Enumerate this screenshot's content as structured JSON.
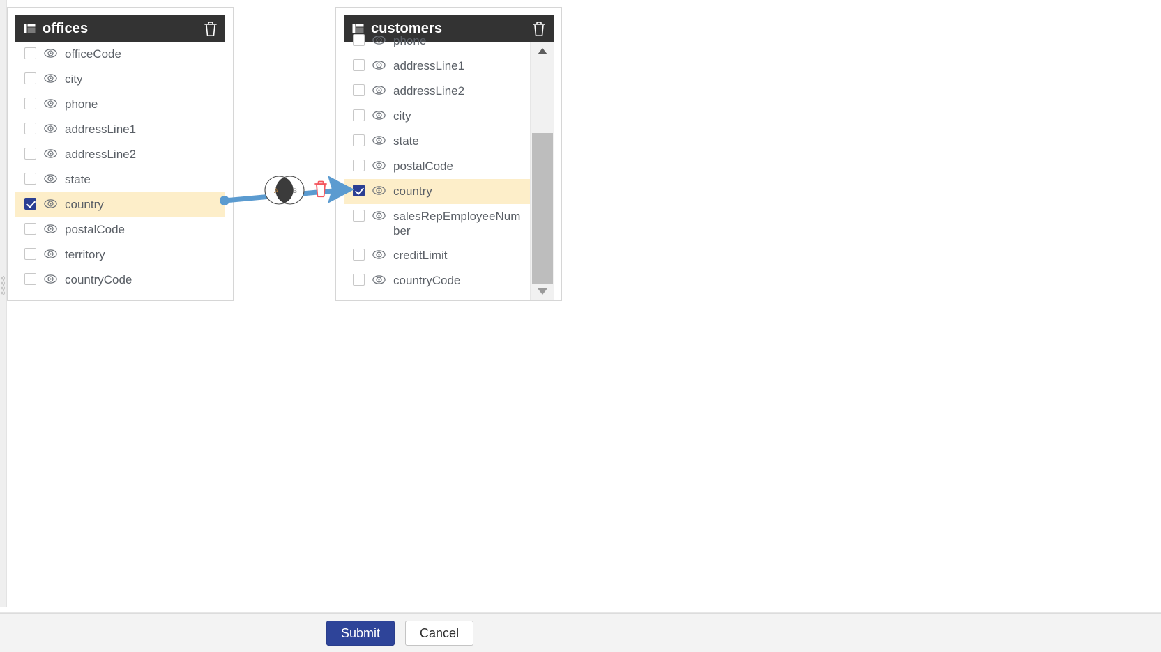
{
  "window": {
    "background": "#ffffff",
    "accent_blue": "#2e4499",
    "selected_row_bg": "#fdeec9",
    "header_bg": "#333333",
    "connector_color": "#5b9bd0",
    "delete_join_color": "#f2545b"
  },
  "tables": [
    {
      "name": "offices",
      "icon": "table-icon",
      "delete_icon": "trash-icon",
      "scrolled": false,
      "fields": [
        {
          "label": "officeCode",
          "checked": false,
          "visibility_icon": "eye-icon"
        },
        {
          "label": "city",
          "checked": false,
          "visibility_icon": "eye-icon"
        },
        {
          "label": "phone",
          "checked": false,
          "visibility_icon": "eye-icon"
        },
        {
          "label": "addressLine1",
          "checked": false,
          "visibility_icon": "eye-icon"
        },
        {
          "label": "addressLine2",
          "checked": false,
          "visibility_icon": "eye-icon"
        },
        {
          "label": "state",
          "checked": false,
          "visibility_icon": "eye-icon"
        },
        {
          "label": "country",
          "checked": true,
          "visibility_icon": "eye-icon"
        },
        {
          "label": "postalCode",
          "checked": false,
          "visibility_icon": "eye-icon"
        },
        {
          "label": "territory",
          "checked": false,
          "visibility_icon": "eye-icon"
        },
        {
          "label": "countryCode",
          "checked": false,
          "visibility_icon": "eye-icon"
        }
      ]
    },
    {
      "name": "customers",
      "icon": "table-icon",
      "delete_icon": "trash-icon",
      "scrolled": true,
      "fields": [
        {
          "label": "phone",
          "checked": false,
          "visibility_icon": "eye-icon"
        },
        {
          "label": "addressLine1",
          "checked": false,
          "visibility_icon": "eye-icon"
        },
        {
          "label": "addressLine2",
          "checked": false,
          "visibility_icon": "eye-icon"
        },
        {
          "label": "city",
          "checked": false,
          "visibility_icon": "eye-icon"
        },
        {
          "label": "state",
          "checked": false,
          "visibility_icon": "eye-icon"
        },
        {
          "label": "postalCode",
          "checked": false,
          "visibility_icon": "eye-icon"
        },
        {
          "label": "country",
          "checked": true,
          "visibility_icon": "eye-icon"
        },
        {
          "label": "salesRepEmployeeNumber",
          "checked": false,
          "visibility_icon": "eye-icon"
        },
        {
          "label": "creditLimit",
          "checked": false,
          "visibility_icon": "eye-icon"
        },
        {
          "label": "countryCode",
          "checked": false,
          "visibility_icon": "eye-icon"
        }
      ],
      "scrollbar": {
        "up_arrow": "caret-up-icon",
        "down_arrow": "caret-down-icon"
      }
    }
  ],
  "join": {
    "type_icon": "inner-join-venn-icon",
    "left_label": "A",
    "right_label": "B",
    "delete_icon": "delete-join-icon",
    "from_table": "offices",
    "from_field": "country",
    "to_table": "customers",
    "to_field": "country"
  },
  "footer": {
    "submit_label": "Submit",
    "cancel_label": "Cancel"
  }
}
